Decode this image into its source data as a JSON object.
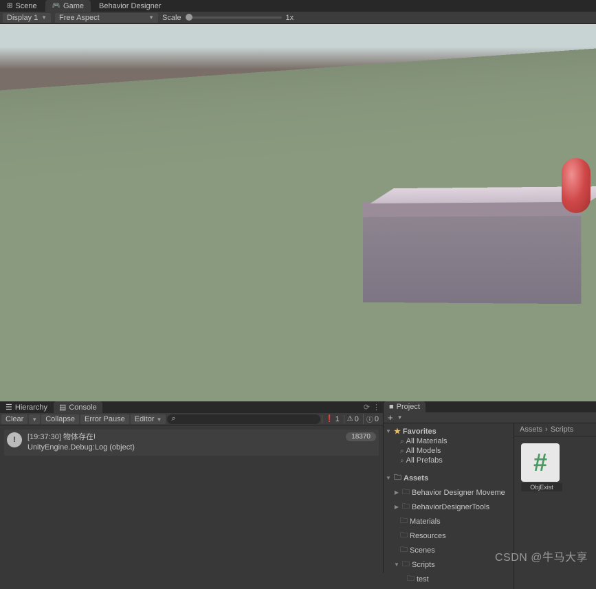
{
  "topTabs": {
    "scene": "Scene",
    "game": "Game",
    "behavior": "Behavior Designer"
  },
  "gameToolbar": {
    "display": "Display 1",
    "aspect": "Free Aspect",
    "scaleLabel": "Scale",
    "scaleValue": "1x"
  },
  "bottomLeft": {
    "tabs": {
      "hierarchy": "Hierarchy",
      "console": "Console"
    },
    "consoleToolbar": {
      "clear": "Clear",
      "collapse": "Collapse",
      "errorPause": "Error Pause",
      "editor": "Editor",
      "errCount": "1",
      "warnCount": "0",
      "infoCount": "0"
    },
    "log": {
      "line1": "[19:37:30] 物体存在!",
      "line2": "UnityEngine.Debug:Log (object)",
      "badge": "18370"
    }
  },
  "project": {
    "tab": "Project",
    "tree": {
      "favorites": "Favorites",
      "allMaterials": "All Materials",
      "allModels": "All Models",
      "allPrefabs": "All Prefabs",
      "assets": "Assets",
      "bdm": "Behavior Designer Moveme",
      "bdt": "BehaviorDesignerTools",
      "materials": "Materials",
      "resources": "Resources",
      "scenes": "Scenes",
      "scripts": "Scripts",
      "test": "test"
    },
    "breadcrumb": {
      "p1": "Assets",
      "p2": "Scripts"
    },
    "asset": {
      "name": "ObjExist"
    }
  },
  "watermark": "CSDN @牛马大享"
}
